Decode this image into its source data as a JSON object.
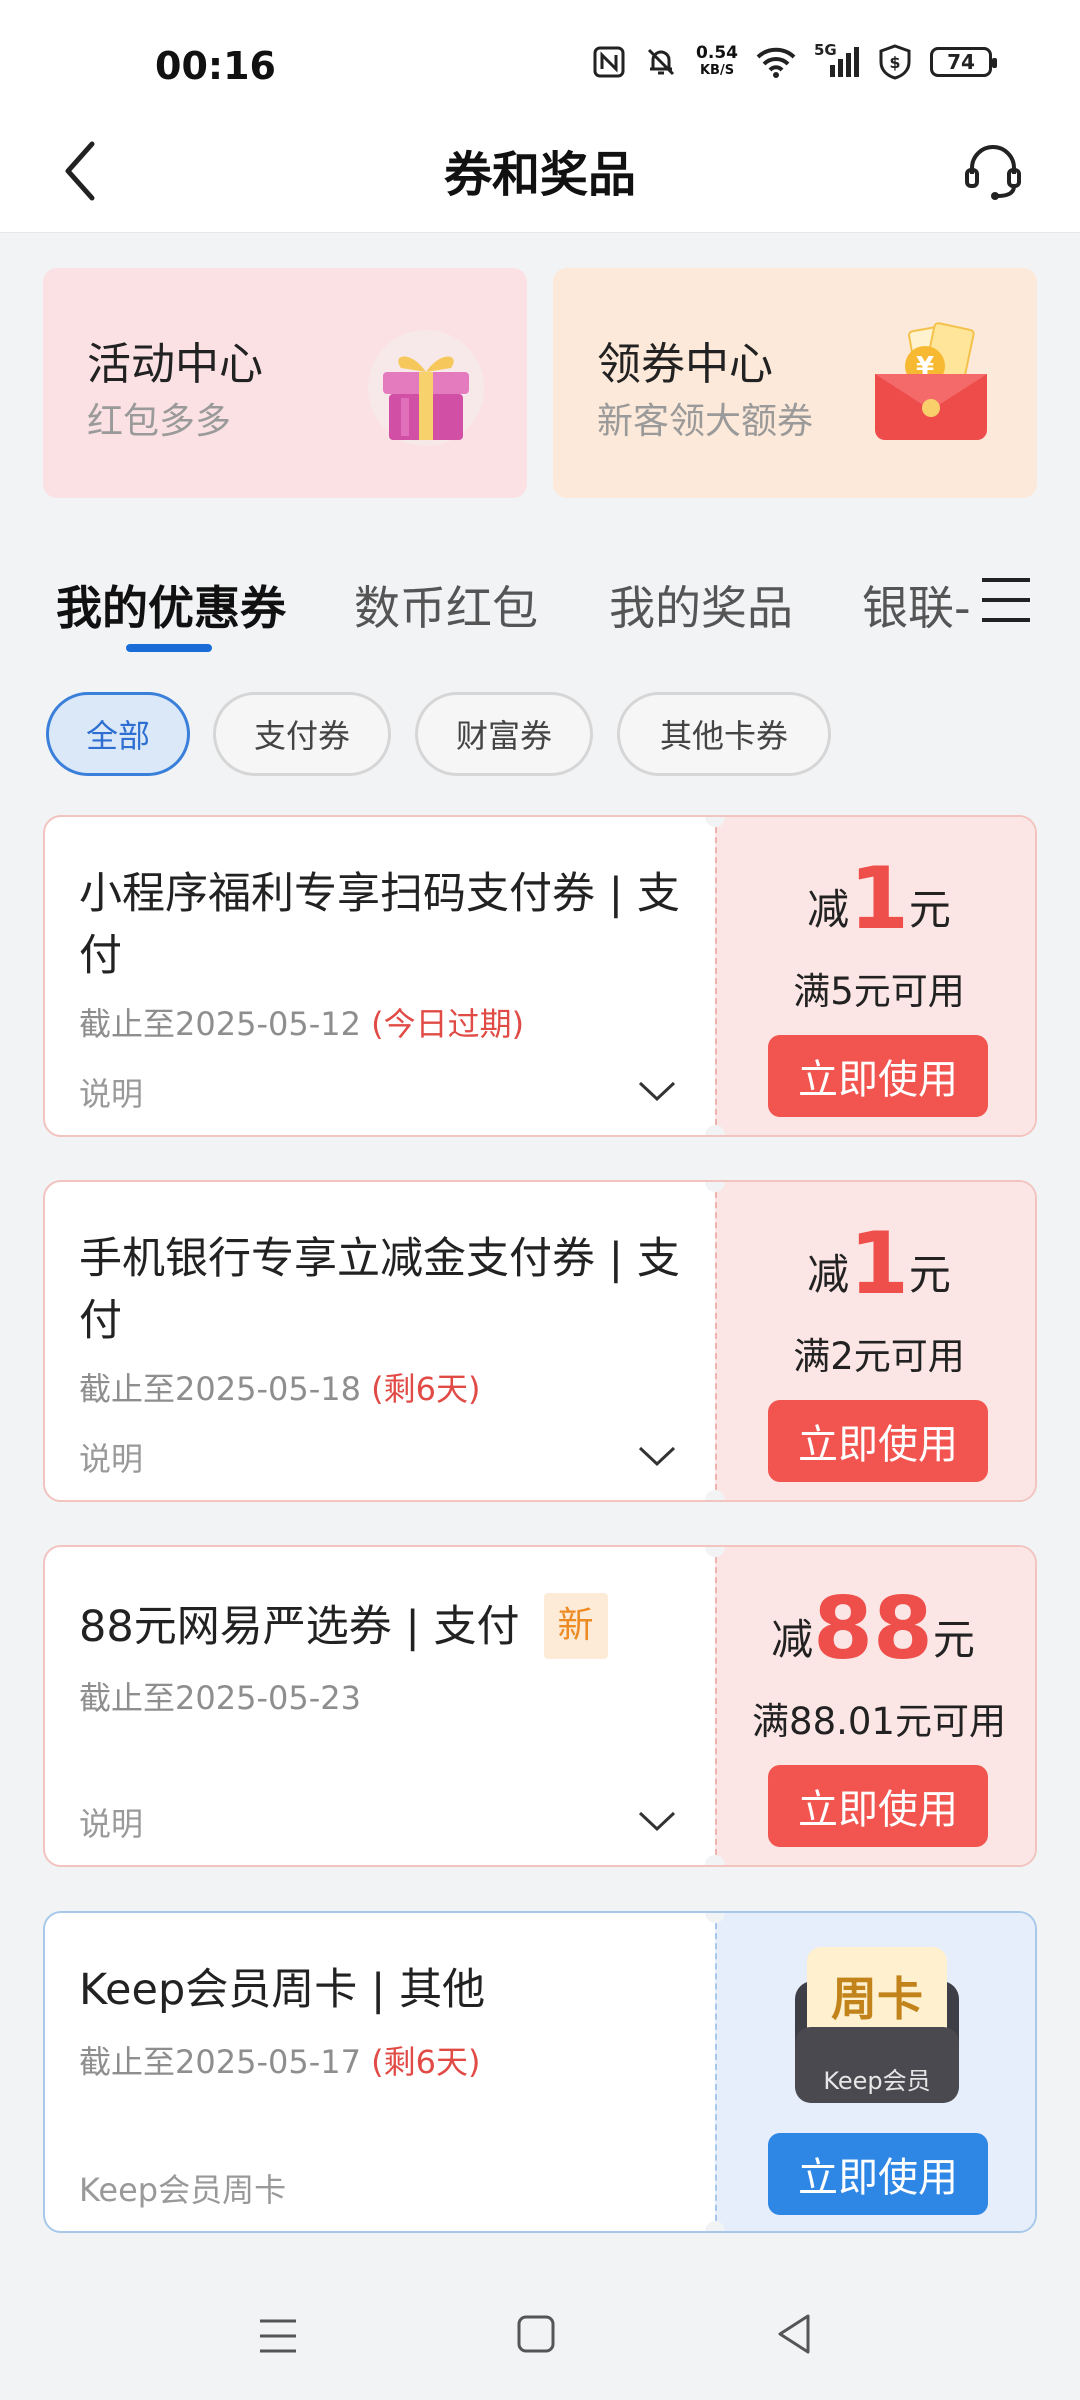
{
  "status_bar": {
    "time": "00:16",
    "net_speed_value": "0.54",
    "net_speed_unit": "KB/S",
    "network": "5G",
    "battery": "74"
  },
  "header": {
    "title": "券和奖品"
  },
  "top_cards": [
    {
      "title": "活动中心",
      "subtitle": "红包多多"
    },
    {
      "title": "领券中心",
      "subtitle": "新客领大额券"
    }
  ],
  "tabs": [
    "我的优惠券",
    "数币红包",
    "我的奖品",
    "银联-"
  ],
  "chips": [
    "全部",
    "支付券",
    "财富券",
    "其他卡券"
  ],
  "coupons": [
    {
      "title": "小程序福利专享扫码支付券 | 支付",
      "date": "截止至2025-05-12",
      "tag": "(今日过期)",
      "desc": "说明",
      "prefix": "减",
      "amount": "1",
      "unit": "元",
      "condition": "满5元可用",
      "button": "立即使用"
    },
    {
      "title": "手机银行专享立减金支付券 | 支付",
      "date": "截止至2025-05-18",
      "tag": "(剩6天)",
      "desc": "说明",
      "prefix": "减",
      "amount": "1",
      "unit": "元",
      "condition": "满2元可用",
      "button": "立即使用"
    },
    {
      "title": "88元网易严选券 | 支付",
      "badge": "新",
      "date": "截止至2025-05-23",
      "desc": "说明",
      "prefix": "减",
      "amount": "88",
      "unit": "元",
      "condition": "满88.01元可用",
      "button": "立即使用"
    },
    {
      "title": "Keep会员周卡 | 其他",
      "date": "截止至2025-05-17",
      "tag": "(剩6天)",
      "desc": "Keep会员周卡",
      "card_title": "周卡",
      "card_sub": "Keep会员",
      "button": "立即使用"
    }
  ],
  "colors": {
    "accent_red": "#f25550",
    "accent_blue": "#2e86e5",
    "tab_underline": "#1a6dd8"
  }
}
